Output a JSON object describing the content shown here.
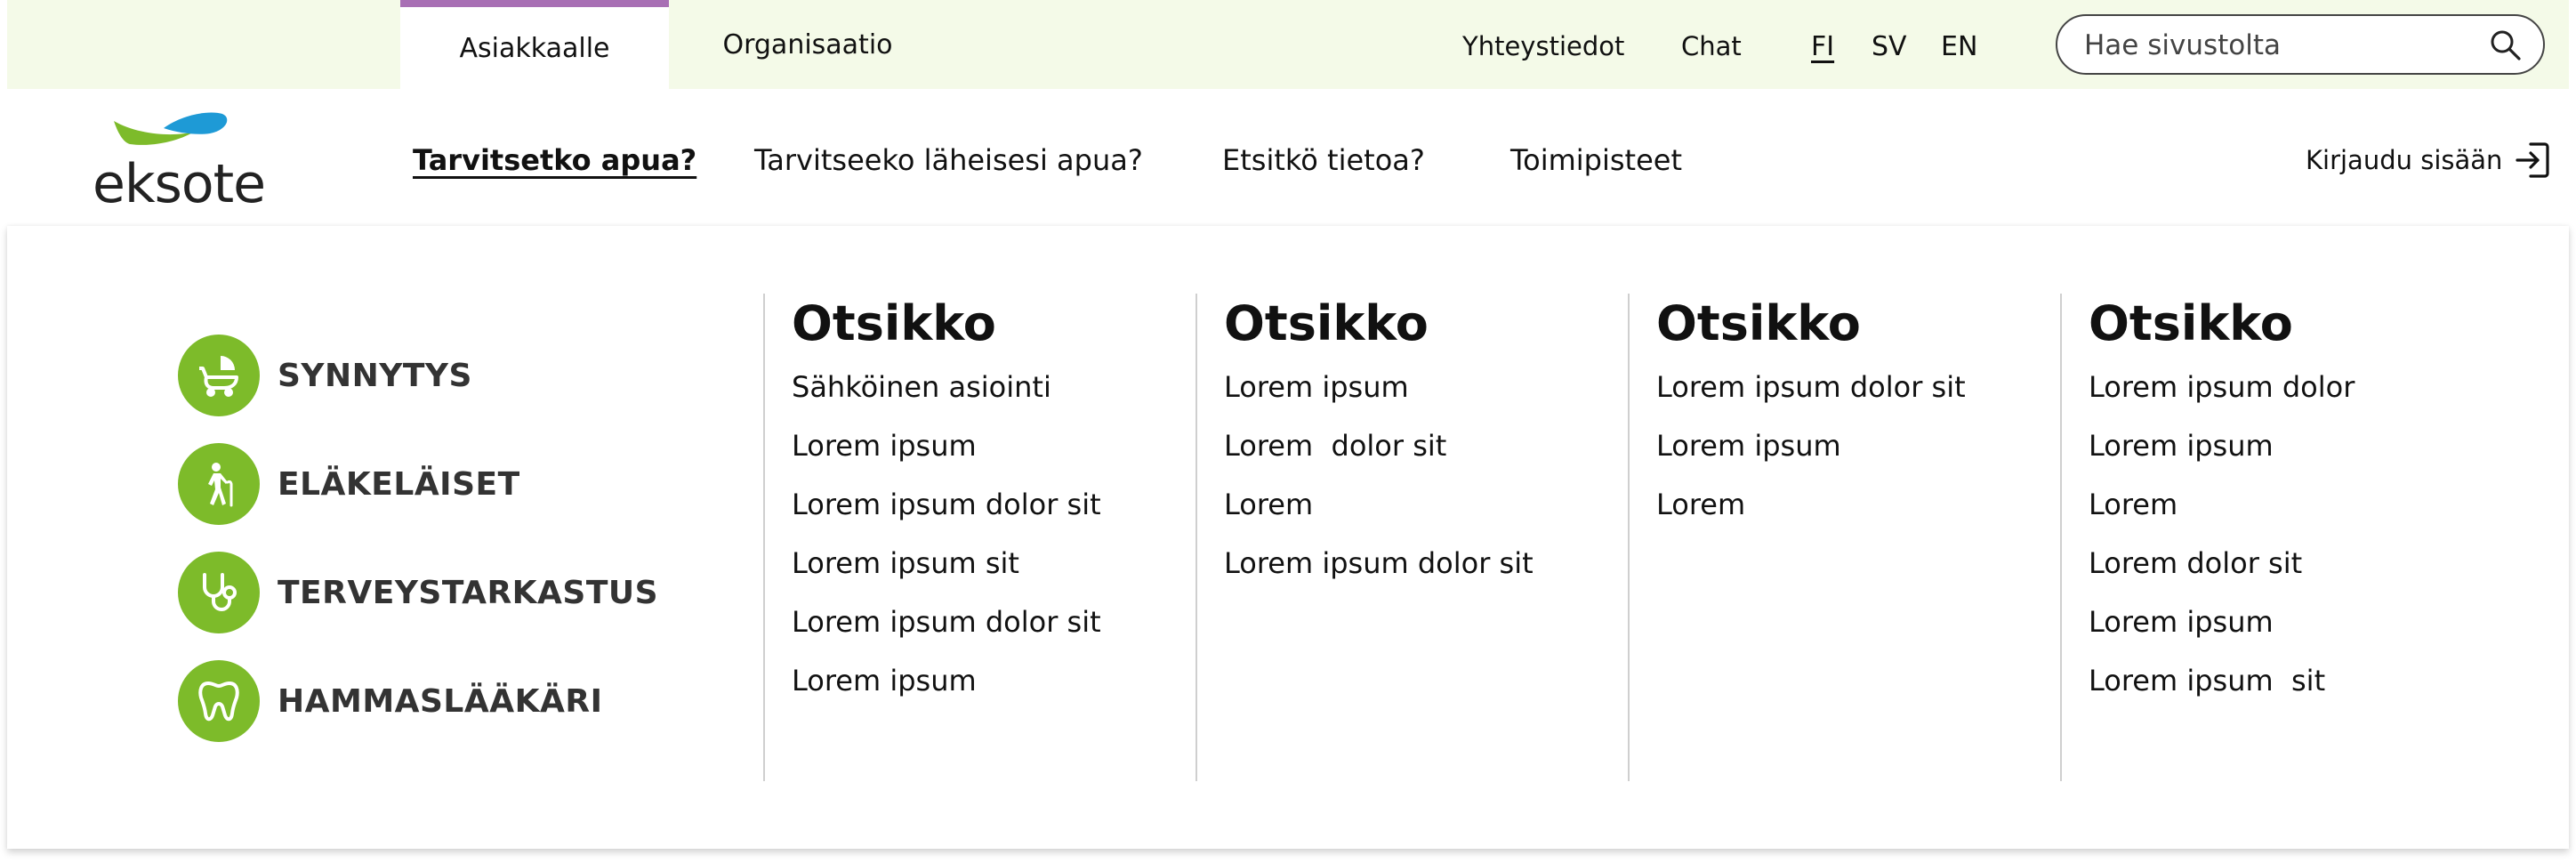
{
  "topbar": {
    "tabs": [
      {
        "label": "Asiakkaalle",
        "active": true
      },
      {
        "label": "Organisaatio",
        "active": false
      }
    ],
    "links": [
      "Yhteystiedot",
      "Chat"
    ],
    "languages": [
      {
        "code": "FI",
        "active": true
      },
      {
        "code": "SV",
        "active": false
      },
      {
        "code": "EN",
        "active": false
      }
    ],
    "search": {
      "placeholder": "Hae sivustolta",
      "icon": "search-icon"
    },
    "active_tab_color": "#a86fb4",
    "background": "#f4fae8"
  },
  "header": {
    "logo_text": "eksote",
    "logo_colors": {
      "green": "#7dbb2a",
      "blue": "#1e9ad6"
    },
    "nav": [
      {
        "label": "Tarvitsetko apua?",
        "active": true
      },
      {
        "label": "Tarvitseeko läheisesi apua?",
        "active": false
      },
      {
        "label": "Etsitkö tietoa?",
        "active": false
      },
      {
        "label": "Toimipisteet",
        "active": false
      }
    ],
    "login": {
      "label": "Kirjaudu sisään",
      "icon": "login-arrow-icon"
    }
  },
  "megamenu": {
    "accent_color": "#7dbb2a",
    "categories": [
      {
        "label": "SYNNYTYS",
        "icon": "baby-carriage-icon"
      },
      {
        "label": "ELÄKELÄISET",
        "icon": "elderly-person-icon"
      },
      {
        "label": "TERVEYSTARKASTUS",
        "icon": "stethoscope-icon"
      },
      {
        "label": "HAMMASLÄÄKÄRI",
        "icon": "tooth-icon"
      }
    ],
    "columns": [
      {
        "title": "Otsikko",
        "links": [
          "Sähköinen asiointi",
          "Lorem ipsum",
          "Lorem ipsum dolor sit",
          "Lorem ipsum sit",
          "Lorem ipsum dolor sit",
          "Lorem ipsum"
        ]
      },
      {
        "title": "Otsikko",
        "links": [
          "Lorem ipsum",
          "Lorem  dolor sit",
          "Lorem",
          "Lorem ipsum dolor sit"
        ]
      },
      {
        "title": "Otsikko",
        "links": [
          "Lorem ipsum dolor sit",
          "Lorem ipsum",
          "Lorem"
        ]
      },
      {
        "title": "Otsikko",
        "links": [
          "Lorem ipsum dolor",
          "Lorem ipsum",
          "Lorem",
          "Lorem dolor sit",
          "Lorem ipsum",
          "Lorem ipsum  sit"
        ]
      }
    ]
  }
}
